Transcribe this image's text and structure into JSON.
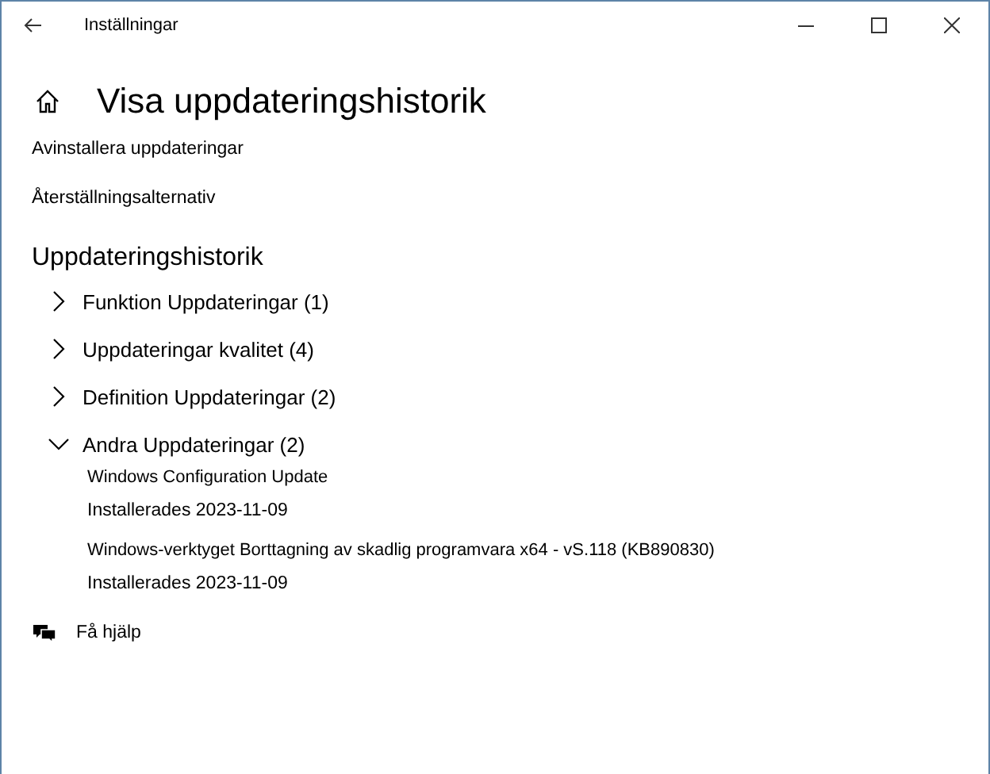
{
  "window": {
    "title": "Inställningar"
  },
  "page_title": "Visa uppdateringshistorik",
  "links": [
    "Avinstallera uppdateringar",
    "Återställningsalternativ"
  ],
  "section_title": "Uppdateringshistorik",
  "groups": [
    {
      "label": "Funktion Uppdateringar (1)",
      "expanded": false
    },
    {
      "label": "Uppdateringar kvalitet (4)",
      "expanded": false
    },
    {
      "label": "Definition Uppdateringar (2)",
      "expanded": false
    },
    {
      "label": "Andra Uppdateringar (2)",
      "expanded": true,
      "children": [
        {
          "name": "Windows Configuration Update",
          "status": "Installerades 2023-11-09"
        },
        {
          "name": "Windows-verktyget Borttagning av skadlig programvara x64 - vS.118 (KB890830)",
          "status": "Installerades 2023-11-09"
        }
      ]
    }
  ],
  "help": "Få hjälp"
}
